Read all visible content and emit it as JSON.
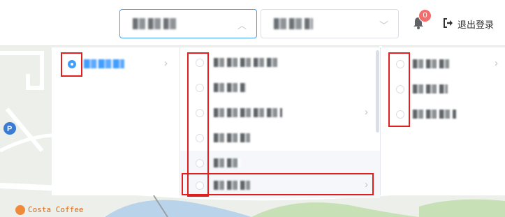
{
  "header": {
    "select_primary": {
      "value": "",
      "caret": "up"
    },
    "select_secondary": {
      "value": "",
      "caret": "down"
    },
    "notifications": {
      "count": "0"
    },
    "logout_label": "退出登录"
  },
  "map": {
    "poi_label": "Costa Coffee",
    "top_street_label": ""
  },
  "cascader": {
    "column1": [
      {
        "label": "",
        "checked": true,
        "has_children": true
      }
    ],
    "column2": [
      {
        "label": "",
        "checked": false,
        "has_children": false
      },
      {
        "label": "",
        "checked": false,
        "has_children": false
      },
      {
        "label": "",
        "checked": false,
        "has_children": true
      },
      {
        "label": "",
        "checked": false,
        "has_children": false
      },
      {
        "label": "",
        "checked": false,
        "has_children": false
      },
      {
        "label": "",
        "checked": false,
        "has_children": true
      }
    ],
    "column3": [
      {
        "label": "",
        "checked": false,
        "has_children": true
      },
      {
        "label": "",
        "checked": false,
        "has_children": false
      },
      {
        "label": "",
        "checked": false,
        "has_children": false
      }
    ]
  },
  "colors": {
    "accent": "#409eff",
    "highlight_box": "#e0201f",
    "badge": "#f56c6c"
  }
}
